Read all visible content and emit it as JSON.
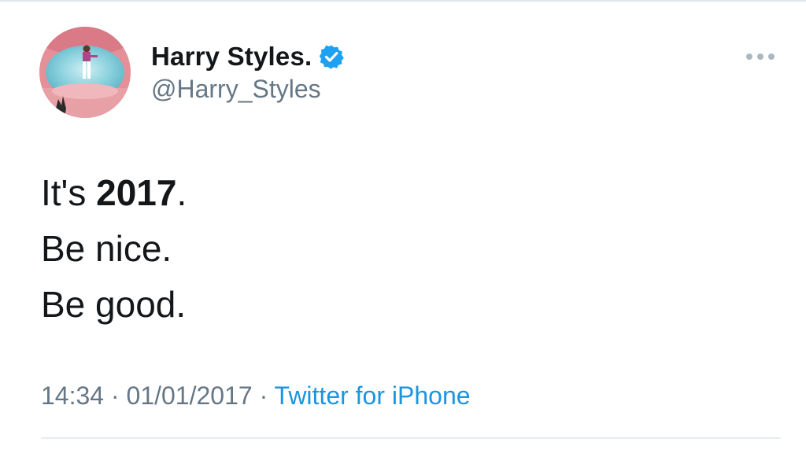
{
  "author": {
    "display_name": "Harry Styles.",
    "handle": "@Harry_Styles",
    "verified": true
  },
  "tweet": {
    "line1_prefix": "It's ",
    "line1_bold": "2017",
    "line1_suffix": ".",
    "line2": "Be nice.",
    "line3": "Be good."
  },
  "meta": {
    "time": "14:34",
    "separator": " · ",
    "date": "01/01/2017",
    "source": "Twitter for iPhone"
  },
  "colors": {
    "text": "#14171a",
    "secondary": "#657786",
    "link": "#1b95e0",
    "verified": "#1da1f2"
  },
  "icons": {
    "more": "more-dots-icon",
    "verified": "verified-badge-icon"
  }
}
